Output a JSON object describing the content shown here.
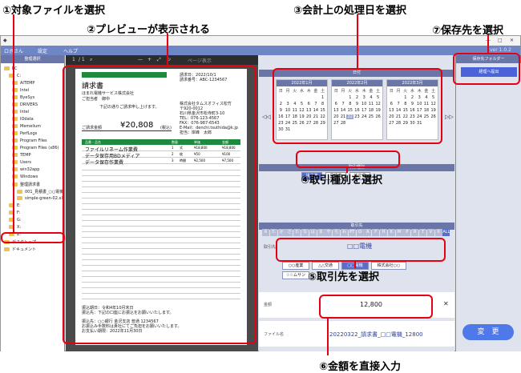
{
  "annotations": {
    "a1": "①対象ファイルを選択",
    "a2": "②プレビューが表示される",
    "a3": "③会計上の処理日を選択",
    "a4": "④取引種別を選択",
    "a5": "⑤取引先を選択",
    "a6": "⑥金額を直接入力",
    "a7": "⑦保存先を選択"
  },
  "app": {
    "title": "",
    "version": "ver 1.0.2",
    "menu": [
      "設定",
      "ヘルプ"
    ],
    "logo": "ロボさん",
    "window_controls": [
      "—",
      "□",
      "✕"
    ]
  },
  "file_tree": {
    "header": "整理選択",
    "items": [
      "PC",
      "C:",
      "AITEMP",
      "Intel",
      "ByeSys",
      "DRIVERS",
      "Intel",
      "IOdata",
      "Memelium",
      "PerfLogs",
      "Program Files",
      "Program Files (x86)",
      "TEMP",
      "Users",
      "win32app",
      "Windows",
      "整理請求書",
      "001_見積書_○○電機",
      "simple-green-02.xls",
      "E:",
      "F:",
      "G:",
      "X:",
      "Z:",
      "デスクトップ",
      "ドキュメント"
    ]
  },
  "pdf_viewer": {
    "page": "1",
    "total": "/ 1",
    "tools": [
      "—",
      "+",
      "⤢",
      "↻"
    ],
    "page_view": "ページ表示"
  },
  "invoice": {
    "title": "請求書",
    "customer": "ほまれ電機サービス株式会社",
    "customer2": "ご担当者　御中",
    "greeting": "下記の通りご請求申し上げます。",
    "date_label": "請求日：",
    "date": "2022/10/1",
    "number_label": "請求番号：",
    "number": "ABC-1234567",
    "company": "株式会社タムスオフィス松竹",
    "zip": "〒920-0012",
    "addr": "石川県金沢市松寺町3-10",
    "tel": "TEL：076-123-4567",
    "fax": "FAX：076-987-6543",
    "email": "E-Mail：denchi.tsuthida@k.jp",
    "person": "担当：岸峰　太郎",
    "total_label": "ご請求金額",
    "total": "¥20,808",
    "tax_note": "(税込)",
    "table_headers": [
      "品番・品名",
      "数量",
      "単価",
      "金額"
    ],
    "rows": [
      {
        "name": "ファイルリネーム作業費",
        "qty": "1",
        "unit": "式",
        "price": "¥18,800",
        "amount": "¥18,800"
      },
      {
        "name": "データ保存用BDメディア",
        "qty": "2",
        "unit": "枚",
        "price": "¥50",
        "amount": "¥100"
      },
      {
        "name": "データ保存作業費",
        "qty": "3",
        "unit": "時間",
        "price": "¥2,500",
        "amount": "¥7,500"
      }
    ],
    "footer1": "振込期日：令和4年10月末日",
    "footer2": "振込先：下記の口座にお振込をお願いいたします。",
    "footer3": "振込先：○○銀行 金沢支店 普通 1234567",
    "footer4": "お振込み手数料は貴社にてご負担をお願いいたします。",
    "footer5": "お支払い期限：2022年11月30日"
  },
  "date_section": {
    "header": "日付",
    "months": [
      {
        "title": "2022年1月",
        "dow": [
          "日",
          "月",
          "火",
          "水",
          "木",
          "金",
          "土"
        ],
        "days": [
          "",
          "",
          "",
          "",
          "",
          "",
          "1",
          "2",
          "3",
          "4",
          "5",
          "6",
          "7",
          "8",
          "9",
          "10",
          "11",
          "12",
          "13",
          "14",
          "15",
          "16",
          "17",
          "18",
          "19",
          "20",
          "21",
          "22",
          "23",
          "24",
          "25",
          "26",
          "27",
          "28",
          "29",
          "30",
          "31"
        ],
        "selected": ""
      },
      {
        "title": "2022年2月",
        "dow": [
          "日",
          "月",
          "火",
          "水",
          "木",
          "金",
          "土"
        ],
        "days": [
          "",
          "",
          "1",
          "2",
          "3",
          "4",
          "5",
          "6",
          "7",
          "8",
          "9",
          "10",
          "11",
          "12",
          "13",
          "14",
          "15",
          "16",
          "17",
          "18",
          "19",
          "20",
          "21",
          "22",
          "23",
          "24",
          "25",
          "26",
          "27",
          "28"
        ],
        "selected": "22"
      },
      {
        "title": "2022年3月",
        "dow": [
          "日",
          "月",
          "火",
          "水",
          "木",
          "金",
          "土"
        ],
        "days": [
          "",
          "",
          "1",
          "2",
          "3",
          "4",
          "5",
          "6",
          "7",
          "8",
          "9",
          "10",
          "11",
          "12",
          "13",
          "14",
          "15",
          "16",
          "17",
          "18",
          "19",
          "20",
          "21",
          "22",
          "23",
          "24",
          "25",
          "26",
          "27",
          "28",
          "29",
          "30",
          "31"
        ],
        "selected": ""
      }
    ],
    "prev": "◁◁",
    "next": "▷▷"
  },
  "trade_type": {
    "header": "取引種別",
    "buttons": [
      "請求書",
      "見積書",
      "注文書"
    ],
    "active": 0
  },
  "vendor": {
    "header": "取引先",
    "kana": [
      "A",
      "た",
      "か",
      "さ",
      "た",
      "な",
      "は",
      "ま",
      "や",
      "ら",
      "わ",
      "PT",
      "O",
      "A",
      "F",
      "H",
      "K",
      "M",
      "P",
      "R",
      "T",
      "V",
      "X",
      "ALL"
    ],
    "label": "取引先",
    "selected": "□□電機",
    "buttons": [
      "○○産業",
      "△△交通",
      "□□電機",
      "株式会社○○",
      "☆☆ムサン"
    ],
    "active": 2
  },
  "amount": {
    "label": "金額",
    "value": "12,800",
    "clear": "✕"
  },
  "filename": {
    "label": "ファイル名",
    "value": "20220322_請求書_□□電機_12800",
    "button": "変　更"
  },
  "save": {
    "header": "保存先フォルダー",
    "button": "経理へ提出"
  }
}
